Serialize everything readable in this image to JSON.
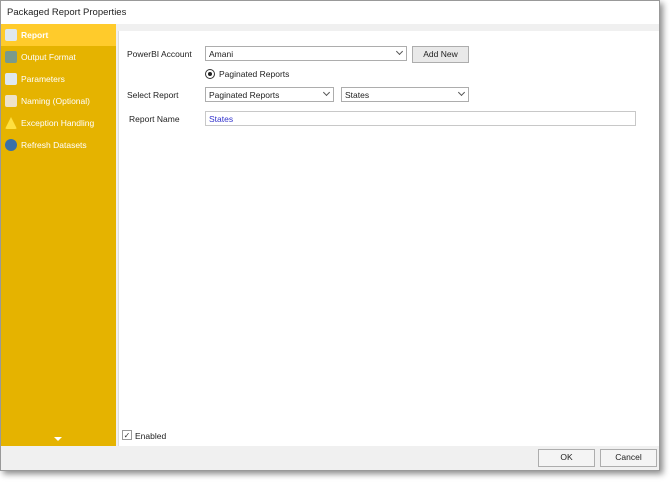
{
  "window": {
    "title": "Packaged Report Properties"
  },
  "sidebar": {
    "items": [
      {
        "label": "Report",
        "icon": "report-icon",
        "color": "#9bb"
      },
      {
        "label": "Output Format",
        "icon": "output-format-icon",
        "color": "#5a7"
      },
      {
        "label": "Parameters",
        "icon": "parameters-icon",
        "color": "#cde"
      },
      {
        "label": "Naming (Optional)",
        "icon": "naming-icon",
        "color": "#dcb"
      },
      {
        "label": "Exception Handling",
        "icon": "warning-icon",
        "color": "#fd3"
      },
      {
        "label": "Refresh Datasets",
        "icon": "refresh-datasets-icon",
        "color": "#37a"
      }
    ]
  },
  "form": {
    "account_label": "PowerBI Account",
    "account_value": "Amani",
    "add_new": "Add New",
    "radio_label": "Paginated Reports",
    "select_report_label": "Select Report",
    "report_type": "Paginated Reports",
    "report_value": "States",
    "report_name_label": "Report Name",
    "report_name_value": "States",
    "enabled_label": "Enabled"
  },
  "footer": {
    "ok": "OK",
    "cancel": "Cancel"
  }
}
